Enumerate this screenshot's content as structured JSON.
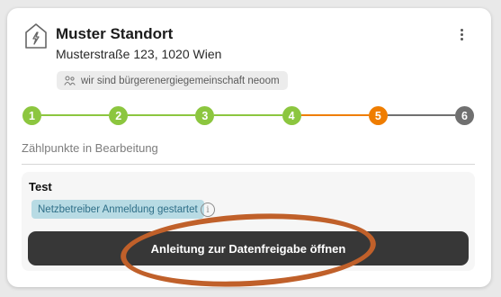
{
  "location": {
    "title": "Muster Standort",
    "address": "Musterstraße 123, 1020 Wien",
    "icon": "house-lightning-icon",
    "community_tag": {
      "icon": "people-icon",
      "label": "wir sind bürgerenergiegemeinschaft neoom"
    },
    "menu_icon": "kebab-menu-icon"
  },
  "stepper": {
    "current_step": 5,
    "steps": [
      {
        "label": "1",
        "state": "done"
      },
      {
        "label": "2",
        "state": "done"
      },
      {
        "label": "3",
        "state": "done"
      },
      {
        "label": "4",
        "state": "done"
      },
      {
        "label": "5",
        "state": "current"
      },
      {
        "label": "6",
        "state": "pending"
      }
    ],
    "colors": {
      "done": "#8cc63f",
      "current": "#ef7d00",
      "pending": "#707070"
    }
  },
  "metering_points": {
    "section_label": "Zählpunkte in Bearbeitung",
    "items": [
      {
        "name": "Test",
        "status": "Netzbetreiber Anmeldung gestartet",
        "status_color": "#b8dbe4",
        "info_icon": "info-icon",
        "button_label": "Anleitung zur Datenfreigabe öffnen"
      }
    ]
  },
  "annotation": {
    "color": "#c0602a",
    "shape": "ellipse"
  }
}
